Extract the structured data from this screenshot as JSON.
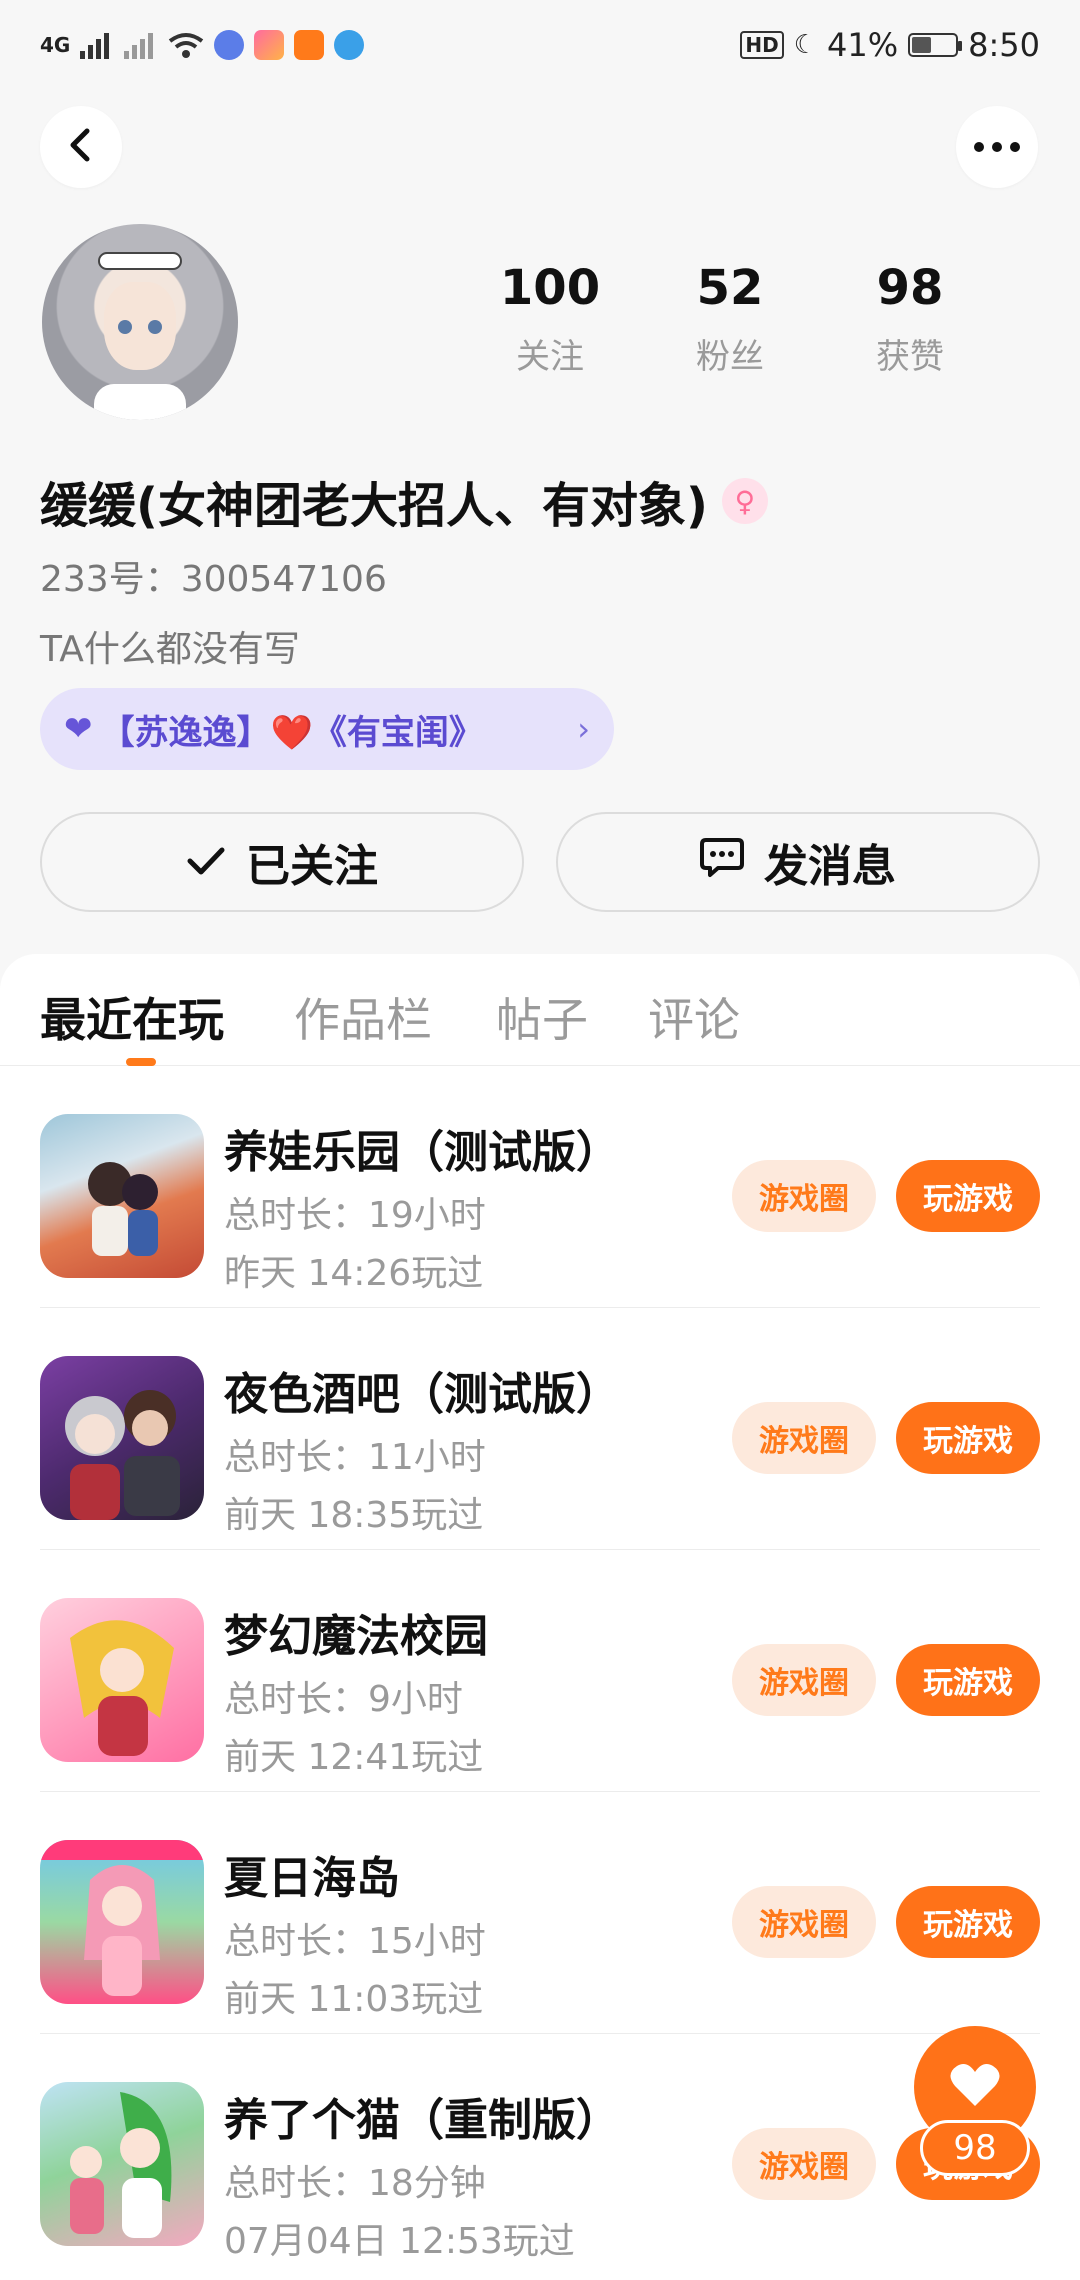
{
  "status_bar": {
    "network": "4G",
    "battery": "41%",
    "battery_level": 0.41,
    "time": "8:50",
    "hd": "HD"
  },
  "header": {
    "back_icon": "chevron-left-icon",
    "more_icon": "more-horizontal-icon"
  },
  "profile": {
    "stats": [
      {
        "value": "100",
        "label": "关注"
      },
      {
        "value": "52",
        "label": "粉丝"
      },
      {
        "value": "98",
        "label": "获赞"
      }
    ],
    "name": "缓缓(女神团老大招人、有对象)",
    "gender": "female",
    "uid": "233号：300547106",
    "bio": "TA什么都没有写",
    "relation": "【苏逸逸】❤️《有宝闺》",
    "follow_label": "已关注",
    "message_label": "发消息"
  },
  "tabs": [
    "最近在玩",
    "作品栏",
    "帖子",
    "评论"
  ],
  "games": [
    {
      "title": "养娃乐园（测试版）",
      "duration": "总时长：19小时",
      "last_played": "昨天 14:26玩过",
      "circle_label": "游戏圈",
      "play_label": "玩游戏"
    },
    {
      "title": "夜色酒吧（测试版）",
      "duration": "总时长：11小时",
      "last_played": "前天 18:35玩过",
      "circle_label": "游戏圈",
      "play_label": "玩游戏"
    },
    {
      "title": "梦幻魔法校园",
      "duration": "总时长：9小时",
      "last_played": "前天 12:41玩过",
      "circle_label": "游戏圈",
      "play_label": "玩游戏"
    },
    {
      "title": "夏日海岛",
      "duration": "总时长：15小时",
      "last_played": "前天 11:03玩过",
      "circle_label": "游戏圈",
      "play_label": "玩游戏"
    },
    {
      "title": "养了个猫（重制版）",
      "duration": "总时长：18分钟",
      "last_played": "07月04日 12:53玩过",
      "circle_label": "游戏圈",
      "play_label": "玩游戏"
    }
  ],
  "fab": {
    "icon": "heart-icon",
    "count": "98"
  },
  "colors": {
    "accent": "#ff7218",
    "accent_light": "#fde9dc",
    "relation_bg": "#e6e2fb",
    "relation_text": "#5b4bd1"
  }
}
